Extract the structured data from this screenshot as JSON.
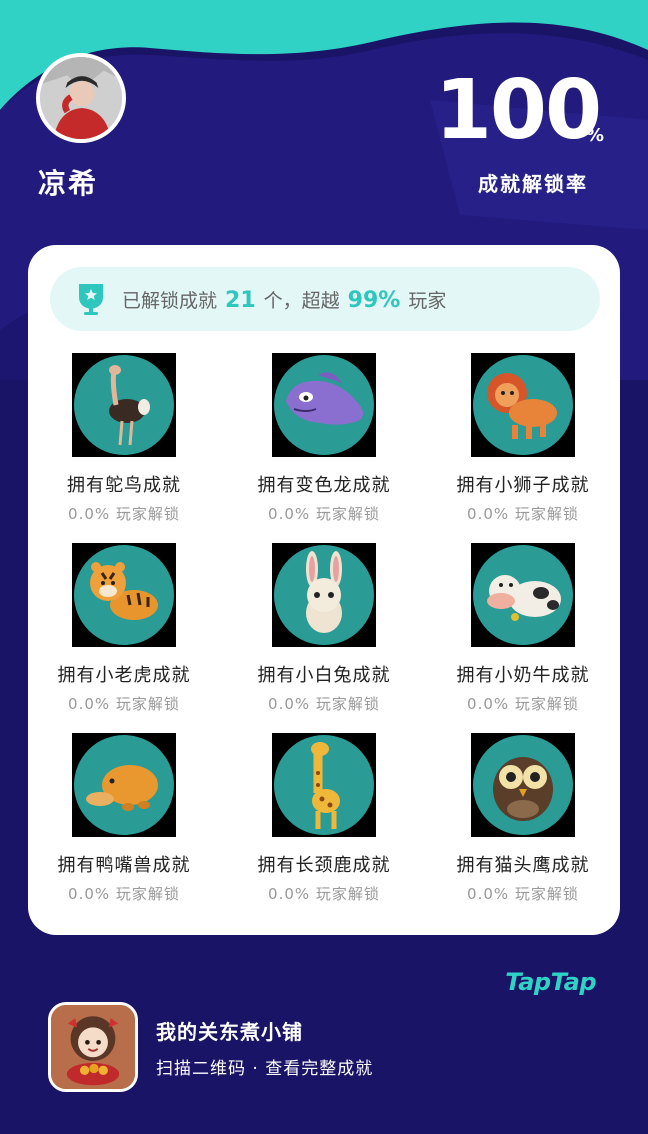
{
  "profile": {
    "username": "凉希",
    "avatar_icon": "user-photo"
  },
  "unlock_rate": {
    "value": "100",
    "percent_sign": "%",
    "label": "成就解锁率"
  },
  "summary": {
    "prefix": "已解锁成就",
    "count": "21",
    "middle": "个，超越",
    "percent": "99%",
    "suffix": "玩家",
    "icon": "trophy-icon"
  },
  "achievements": [
    {
      "title": "拥有鸵鸟成就",
      "sub": "0.0% 玩家解锁",
      "icon": "ostrich-icon"
    },
    {
      "title": "拥有变色龙成就",
      "sub": "0.0% 玩家解锁",
      "icon": "chameleon-icon"
    },
    {
      "title": "拥有小狮子成就",
      "sub": "0.0% 玩家解锁",
      "icon": "lion-icon"
    },
    {
      "title": "拥有小老虎成就",
      "sub": "0.0% 玩家解锁",
      "icon": "tiger-icon"
    },
    {
      "title": "拥有小白兔成就",
      "sub": "0.0% 玩家解锁",
      "icon": "rabbit-icon"
    },
    {
      "title": "拥有小奶牛成就",
      "sub": "0.0% 玩家解锁",
      "icon": "cow-icon"
    },
    {
      "title": "拥有鸭嘴兽成就",
      "sub": "0.0% 玩家解锁",
      "icon": "platypus-icon"
    },
    {
      "title": "拥有长颈鹿成就",
      "sub": "0.0% 玩家解锁",
      "icon": "giraffe-icon"
    },
    {
      "title": "拥有猫头鹰成就",
      "sub": "0.0% 玩家解锁",
      "icon": "owl-icon"
    }
  ],
  "brand": "TapTap",
  "game": {
    "title": "我的关东煮小铺",
    "subtitle": "扫描二维码 · 查看完整成就",
    "icon": "game-app-icon"
  },
  "colors": {
    "background": "#1a1466",
    "accent": "#2fc6bd",
    "card": "#ffffff",
    "thumb_circle": "#2a9b95"
  }
}
